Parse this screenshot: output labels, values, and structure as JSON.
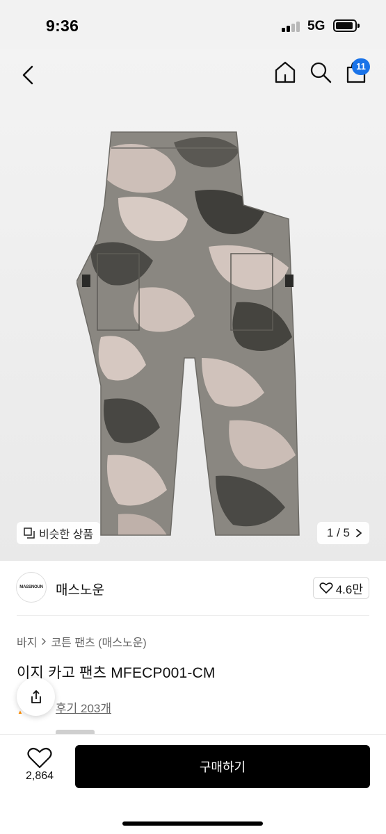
{
  "status_bar": {
    "time": "9:36",
    "network": "5G",
    "icons": [
      "signal-icon",
      "battery-icon"
    ]
  },
  "nav": {
    "icons": [
      "back-icon",
      "home-icon",
      "search-icon",
      "cart-icon"
    ],
    "cart_badge": "11",
    "badge_color": "#1a73e8"
  },
  "gallery": {
    "similar_label": "비슷한 상품",
    "page_indicator": "1 / 5"
  },
  "brand": {
    "logo_text": "MASSNOUN",
    "name": "매스노운",
    "likes": "4.6만"
  },
  "product": {
    "breadcrumb": [
      "바지",
      "코튼 팬츠 (매스노운)"
    ],
    "title": "이지 카고 팬츠 MFECP001-CM",
    "review_link": "후기 203개"
  },
  "bottom_bar": {
    "wish_count": "2,864",
    "buy_label": "구매하기"
  },
  "colors": {
    "primary_button": "#000000",
    "accent": "#1a73e8"
  }
}
